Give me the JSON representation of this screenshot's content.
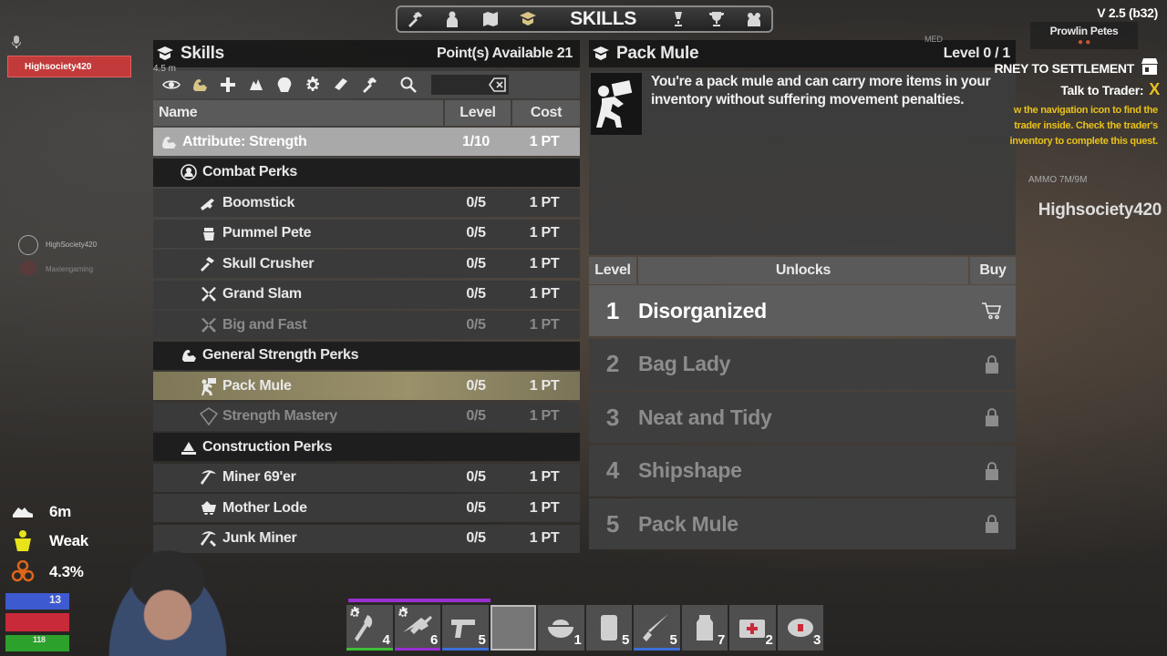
{
  "nav": {
    "title": "SKILLS",
    "left_icons": [
      "hammer-icon",
      "character-icon",
      "map-icon",
      "skills-icon"
    ],
    "right_icons": [
      "challenges-icon",
      "trophy-icon",
      "players-icon"
    ]
  },
  "skills_panel": {
    "title": "Skills",
    "points": "Point(s) Available 21",
    "columns": {
      "name": "Name",
      "level": "Level",
      "cost": "Cost"
    },
    "filter_icons": [
      "eye-icon",
      "strength-icon",
      "perception-plus-icon",
      "fortitude-icon",
      "agility-icon",
      "intellect-gear-icon",
      "book-icon",
      "crafting-icon"
    ],
    "search_placeholder": "",
    "rows": [
      {
        "type": "attr",
        "icon": "strength-arm-icon",
        "name": "Attribute: Strength",
        "level": "1/10",
        "cost": "1 PT"
      },
      {
        "type": "group",
        "icon": "combat-icon",
        "name": "Combat Perks",
        "level": "",
        "cost": ""
      },
      {
        "type": "perk",
        "icon": "shotgun-icon",
        "name": "Boomstick",
        "level": "0/5",
        "cost": "1 PT"
      },
      {
        "type": "perk",
        "icon": "knuckles-icon",
        "name": "Pummel Pete",
        "level": "0/5",
        "cost": "1 PT"
      },
      {
        "type": "perk",
        "icon": "sledgehammer-icon",
        "name": "Skull Crusher",
        "level": "0/5",
        "cost": "1 PT"
      },
      {
        "type": "perk",
        "icon": "crossed-weapons-icon",
        "name": "Grand Slam",
        "level": "0/5",
        "cost": "1 PT"
      },
      {
        "type": "perk dim",
        "icon": "crossed-weapons-icon",
        "name": "Big and Fast",
        "level": "0/5",
        "cost": "1 PT"
      },
      {
        "type": "group",
        "icon": "strength-arm-icon",
        "name": "General Strength Perks",
        "level": "",
        "cost": ""
      },
      {
        "type": "perk selected",
        "icon": "pack-mule-icon",
        "name": "Pack Mule",
        "level": "0/5",
        "cost": "1 PT"
      },
      {
        "type": "perk dim",
        "icon": "mastery-icon",
        "name": "Strength Mastery",
        "level": "0/5",
        "cost": "1 PT"
      },
      {
        "type": "group",
        "icon": "construction-icon",
        "name": "Construction Perks",
        "level": "",
        "cost": ""
      },
      {
        "type": "perk",
        "icon": "pickaxe-icon",
        "name": "Miner 69'er",
        "level": "0/5",
        "cost": "1 PT"
      },
      {
        "type": "perk",
        "icon": "mine-cart-icon",
        "name": "Mother Lode",
        "level": "0/5",
        "cost": "1 PT"
      },
      {
        "type": "perk",
        "icon": "junk-miner-icon",
        "name": "Junk Miner",
        "level": "0/5",
        "cost": "1 PT"
      }
    ]
  },
  "detail_panel": {
    "title": "Pack Mule",
    "level": "Level 0 / 1",
    "description": "You're a pack mule and can carry more items in your inventory without suffering movement penalties.",
    "columns": {
      "level": "Level",
      "unlocks": "Unlocks",
      "buy": "Buy"
    },
    "unlocks": [
      {
        "num": "1",
        "name": "Disorganized",
        "state": "buy",
        "icon": "cart-icon"
      },
      {
        "num": "2",
        "name": "Bag Lady",
        "state": "locked",
        "icon": "lock-icon"
      },
      {
        "num": "3",
        "name": "Neat and Tidy",
        "state": "locked",
        "icon": "lock-icon"
      },
      {
        "num": "4",
        "name": "Shipshape",
        "state": "locked",
        "icon": "lock-icon"
      },
      {
        "num": "5",
        "name": "Pack Mule",
        "state": "locked",
        "icon": "lock-icon"
      }
    ]
  },
  "hud_right": {
    "version": "V 2.5 (b32)",
    "trader_name": "Prowlin Petes",
    "trader_marker": "● ●",
    "quest_title": "RNEY TO SETTLEMENT",
    "quest_objective": "Talk to Trader:",
    "quest_objective_mark": "X",
    "quest_hint": "w the navigation icon to find the trader inside. Check the trader's inventory to complete this quest.",
    "ammo": "AMMO 7M/9M",
    "player_name": "Highsociety420",
    "corner_tag": "MED"
  },
  "hud_left": {
    "party_name": "Highsociety420",
    "mini_dist": "4.5 m",
    "minimap_name": "HighSociety420",
    "minimap_name2": "Maxiengaming",
    "speed": "6m",
    "weight": "Weak",
    "infection": "4.3%",
    "stamina": "13",
    "food": "118"
  },
  "hotbar": {
    "slots": [
      {
        "item": "axe-icon",
        "count": "4",
        "quality": "q-green",
        "gear": true
      },
      {
        "item": "rifle-icon",
        "count": "6",
        "quality": "q-purple",
        "gear": true
      },
      {
        "item": "pistol-icon",
        "count": "5",
        "quality": "q-blue",
        "gear": false
      },
      {
        "item": "",
        "count": "",
        "quality": "empty",
        "gear": false
      },
      {
        "item": "food-bowl-icon",
        "count": "1",
        "quality": "",
        "gear": false
      },
      {
        "item": "can-icon",
        "count": "5",
        "quality": "",
        "gear": false
      },
      {
        "item": "knife-icon",
        "count": "5",
        "quality": "q-blue",
        "gear": false
      },
      {
        "item": "water-jar-icon",
        "count": "7",
        "quality": "",
        "gear": false
      },
      {
        "item": "first-aid-kit-icon",
        "count": "2",
        "quality": "",
        "gear": false
      },
      {
        "item": "bandage-icon",
        "count": "3",
        "quality": "",
        "gear": false
      }
    ]
  }
}
